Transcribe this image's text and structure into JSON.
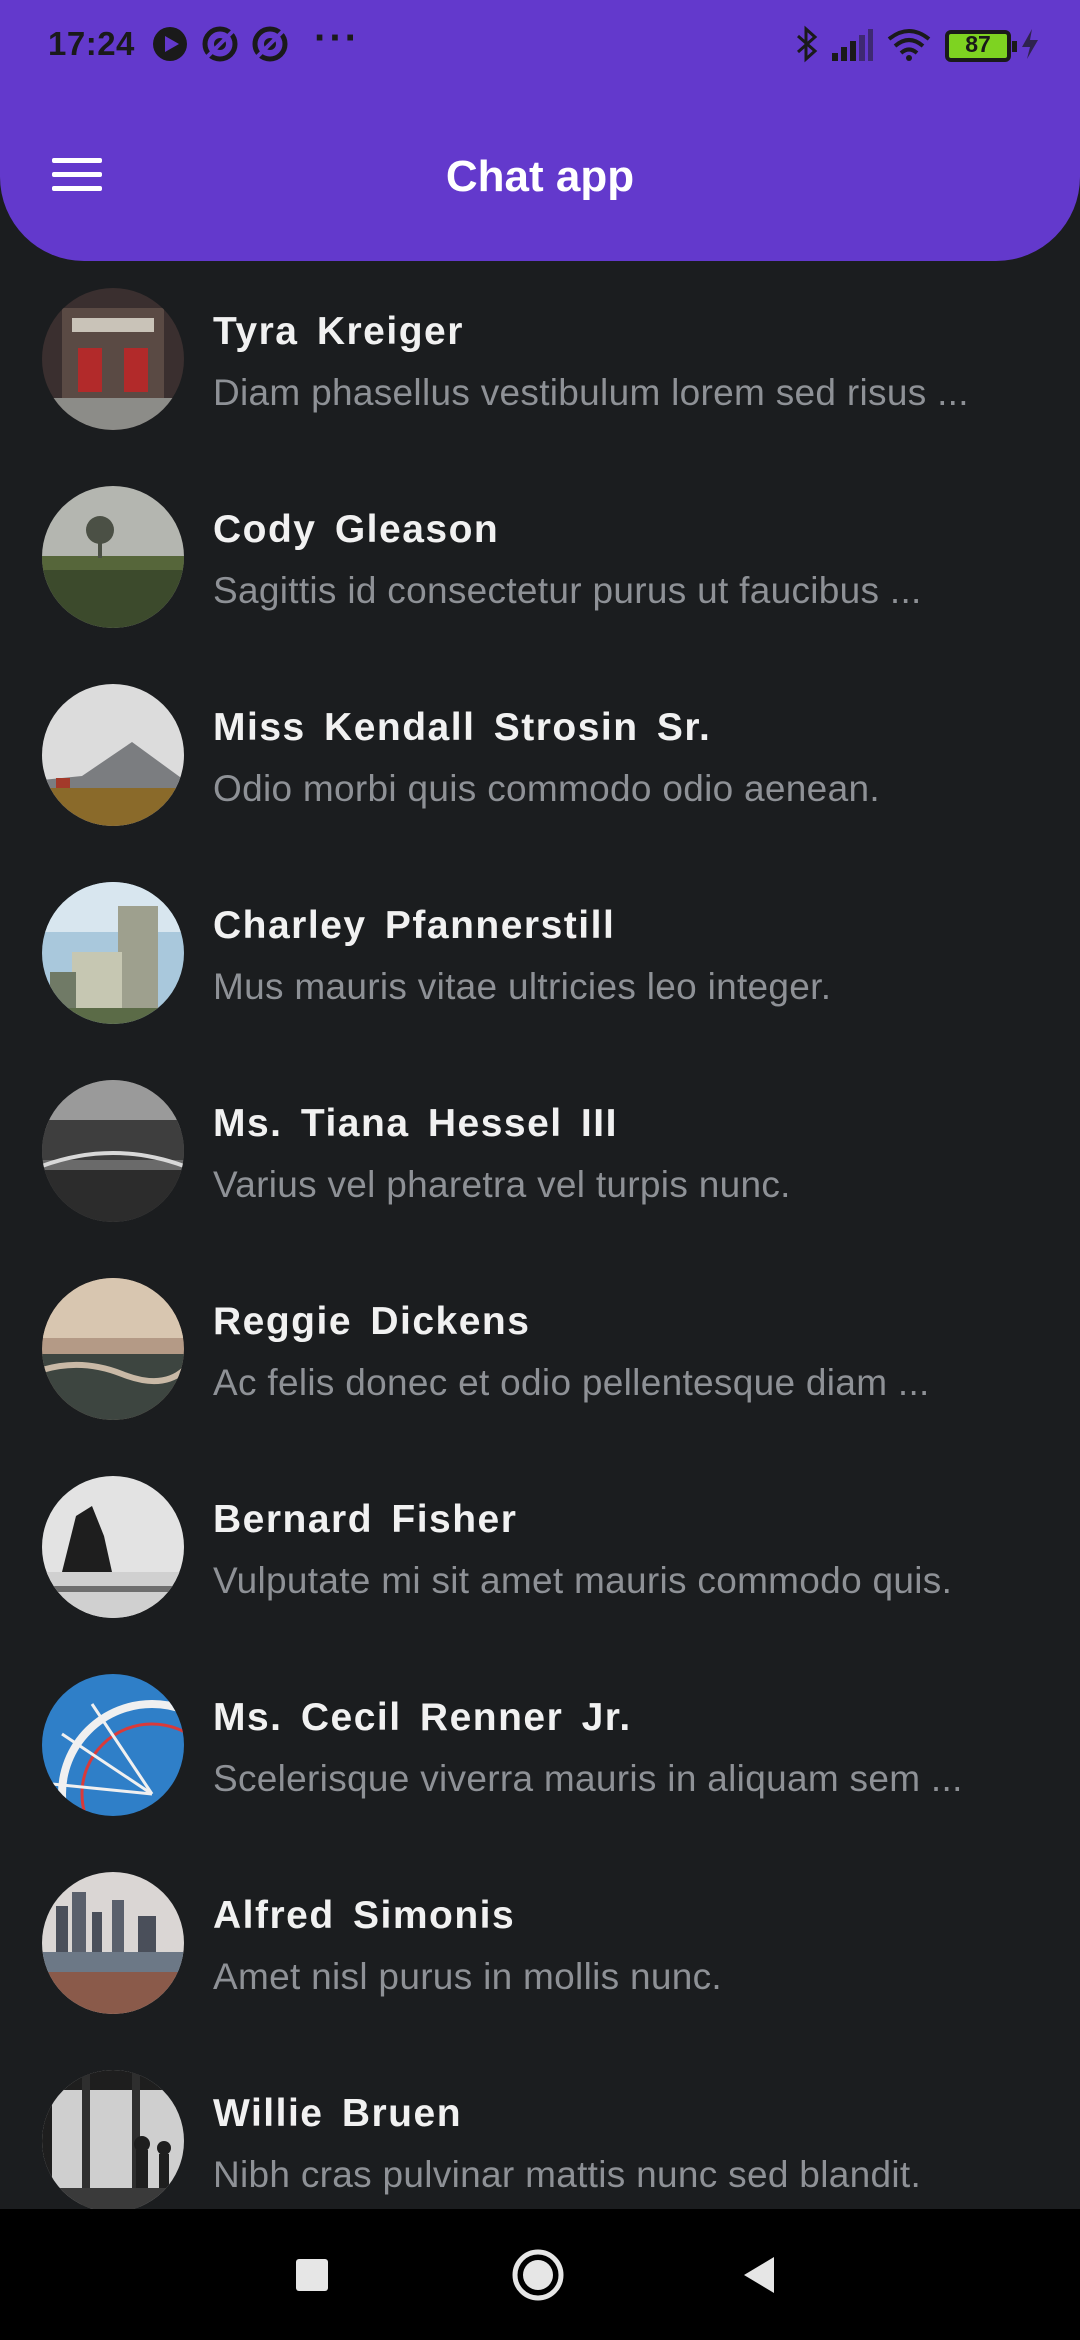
{
  "status_bar": {
    "time": "17:24",
    "battery": "87",
    "icons": [
      "play-icon",
      "sync-icon",
      "sync-icon",
      "more-dots",
      "bluetooth-icon",
      "signal-icon",
      "wifi-icon",
      "battery-icon",
      "charging-icon"
    ]
  },
  "app_bar": {
    "title": "Chat app",
    "menu_icon": "menu-icon",
    "color": "#6339cc"
  },
  "chats": [
    {
      "name": "Tyra Kreiger",
      "message": "Diam phasellus vestibulum lorem sed risus ..."
    },
    {
      "name": "Cody Gleason",
      "message": "Sagittis id consectetur purus ut faucibus ..."
    },
    {
      "name": "Miss Kendall Strosin Sr.",
      "message": "Odio morbi quis commodo odio aenean."
    },
    {
      "name": "Charley Pfannerstill",
      "message": "Mus mauris vitae ultricies leo integer."
    },
    {
      "name": "Ms. Tiana Hessel III",
      "message": "Varius vel pharetra vel turpis nunc."
    },
    {
      "name": "Reggie Dickens",
      "message": "Ac felis donec et odio pellentesque diam ..."
    },
    {
      "name": "Bernard Fisher",
      "message": "Vulputate mi sit amet mauris commodo quis."
    },
    {
      "name": "Ms. Cecil Renner Jr.",
      "message": "Scelerisque viverra mauris in aliquam sem ..."
    },
    {
      "name": "Alfred Simonis",
      "message": "Amet nisl purus in mollis nunc."
    },
    {
      "name": "Willie Bruen",
      "message": "Nibh cras pulvinar mattis nunc sed blandit."
    }
  ],
  "nav_bar": {
    "recents": "recents-square-icon",
    "home": "home-circle-icon",
    "back": "back-triangle-icon"
  }
}
